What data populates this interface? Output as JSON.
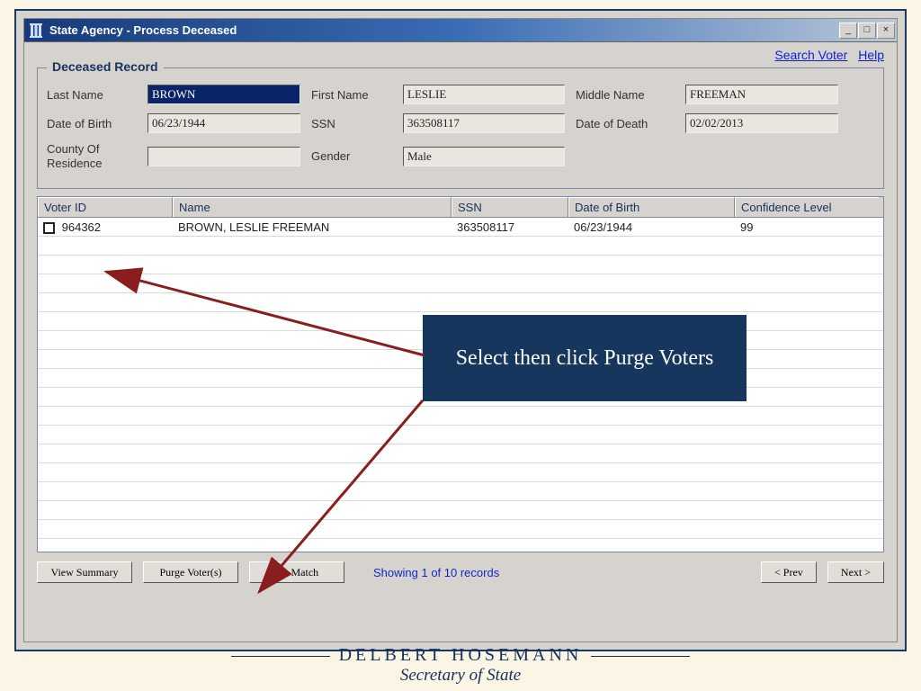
{
  "window": {
    "title": "State Agency - Process Deceased"
  },
  "links": {
    "search_voter": "Search Voter",
    "help": "Help"
  },
  "group": {
    "title": "Deceased Record",
    "labels": {
      "last_name": "Last Name",
      "first_name": "First Name",
      "middle_name": "Middle Name",
      "dob": "Date of Birth",
      "ssn": "SSN",
      "dod": "Date of Death",
      "county": "County Of Residence",
      "gender": "Gender"
    },
    "values": {
      "last_name": "BROWN",
      "first_name": "LESLIE",
      "middle_name": "FREEMAN",
      "dob": "06/23/1944",
      "ssn": "363508117",
      "dod": "02/02/2013",
      "county": "",
      "gender": "Male"
    }
  },
  "grid": {
    "headers": {
      "voter_id": "Voter ID",
      "name": "Name",
      "ssn": "SSN",
      "dob": "Date of Birth",
      "confidence": "Confidence Level"
    },
    "rows": [
      {
        "voter_id": "964362",
        "name": "BROWN, LESLIE FREEMAN",
        "ssn": "363508117",
        "dob": "06/23/1944",
        "confidence": "99"
      }
    ]
  },
  "footer": {
    "view_summary": "View Summary",
    "purge": "Purge Voter(s)",
    "no_match": "No Match",
    "status": "Showing 1 of 10 records",
    "prev": "<  Prev",
    "next": "Next >"
  },
  "callout": {
    "text": "Select then click Purge Voters"
  },
  "branding": {
    "line1": "DELBERT HOSEMANN",
    "line2": "Secretary of State"
  }
}
